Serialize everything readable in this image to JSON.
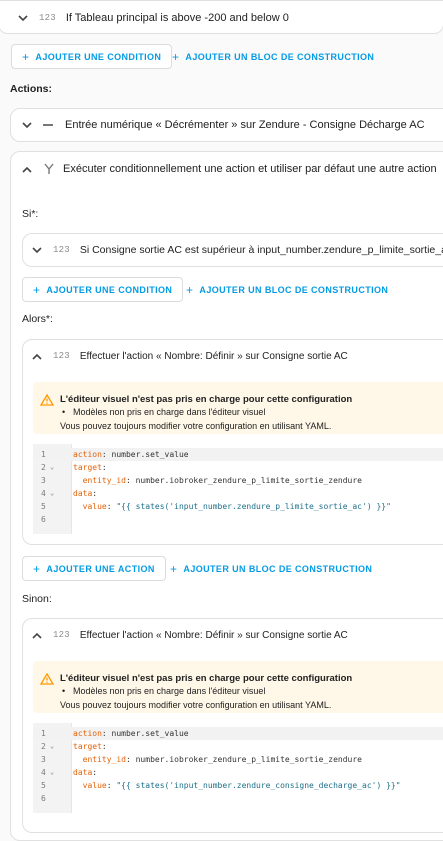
{
  "top_condition": {
    "icon_text": "123",
    "label": "If Tableau principal is above -200 and below 0"
  },
  "top_buttons": {
    "add_condition": "AJOUTER UNE CONDITION",
    "add_block": "AJOUTER UN BLOC DE CONSTRUCTION"
  },
  "actions_label": "Actions:",
  "action1": {
    "label": "Entrée numérique « Décrémenter » sur Zendure - Consigne Décharge AC"
  },
  "action2": {
    "label": "Exécuter conditionnellement une action et utiliser par défaut une autre action"
  },
  "si_label": "Si*:",
  "si_condition": {
    "icon_text": "123",
    "label": "Si Consigne sortie AC est supérieur à input_number.zendure_p_limite_sortie_ac"
  },
  "si_buttons": {
    "add_condition": "AJOUTER UNE CONDITION",
    "add_block": "AJOUTER UN BLOC DE CONSTRUCTION"
  },
  "alors_label": "Alors*:",
  "alors_action": {
    "icon_text": "123",
    "label": "Effectuer l'action « Nombre: Définir » sur Consigne sortie AC",
    "warning": {
      "title": "L'éditeur visuel n'est pas pris en charge pour cette configuration",
      "bullet": "Modèles non pris en charge dans l'éditeur visuel",
      "note": "Vous pouvez toujours modifier votre configuration en utilisant YAML."
    },
    "code": [
      {
        "n": "1",
        "key": "action",
        "rest": ": number.set_value"
      },
      {
        "n": "2",
        "key": "target",
        "rest": ":"
      },
      {
        "n": "3",
        "key": "  entity_id",
        "rest": ": number.iobroker_zendure_p_limite_sortie_zendure"
      },
      {
        "n": "4",
        "key": "data",
        "rest": ":"
      },
      {
        "n": "5",
        "key": "  value",
        "rest": ": \"{{ states('input_number.zendure_p_limite_sortie_ac') }}\""
      },
      {
        "n": "6",
        "key": "",
        "rest": ""
      }
    ]
  },
  "alors_buttons": {
    "add_action": "AJOUTER UNE ACTION",
    "add_block": "AJOUTER UN BLOC DE CONSTRUCTION"
  },
  "sinon_label": "Sinon:",
  "sinon_action": {
    "icon_text": "123",
    "label": "Effectuer l'action « Nombre: Définir » sur Consigne sortie AC",
    "warning": {
      "title": "L'éditeur visuel n'est pas pris en charge pour cette configuration",
      "bullet": "Modèles non pris en charge dans l'éditeur visuel",
      "note": "Vous pouvez toujours modifier votre configuration en utilisant YAML."
    },
    "code": [
      {
        "n": "1",
        "key": "action",
        "rest": ": number.set_value"
      },
      {
        "n": "2",
        "key": "target",
        "rest": ":"
      },
      {
        "n": "3",
        "key": "  entity_id",
        "rest": ": number.iobroker_zendure_p_limite_sortie_zendure"
      },
      {
        "n": "4",
        "key": "data",
        "rest": ":"
      },
      {
        "n": "5",
        "key": "  value",
        "rest": ": \"{{ states('input_number.zendure_consigne_decharge_ac') }}\""
      },
      {
        "n": "6",
        "key": "",
        "rest": ""
      }
    ]
  },
  "colors": {
    "accent": "#039be5",
    "warning_bg": "#fff8e8",
    "warning_icon": "#ff9800"
  }
}
